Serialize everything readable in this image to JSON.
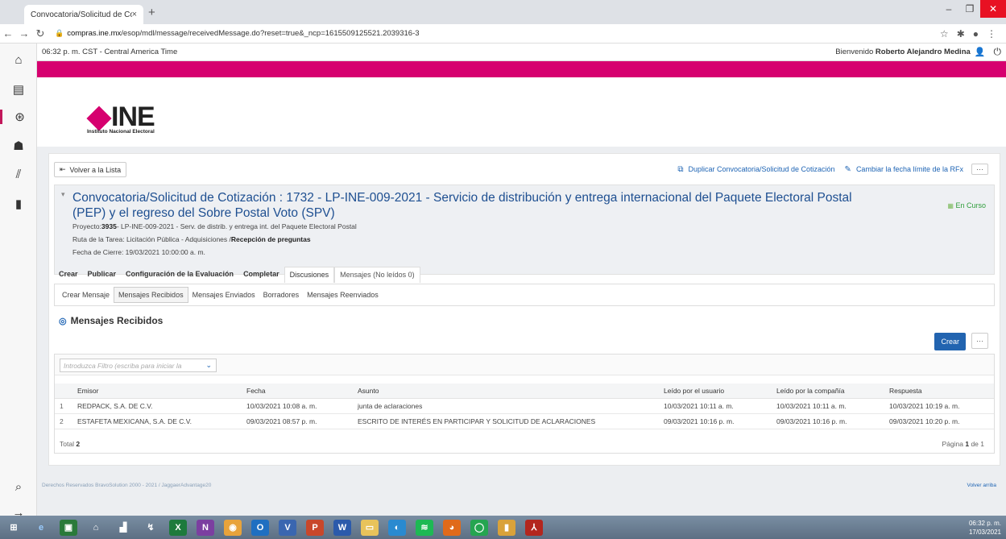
{
  "browser": {
    "tab_title": "Convocatoria/Solicitud de Cotiza",
    "tab_close": "×",
    "new_tab": "+",
    "url_prefix": "compras.ine.mx",
    "url_path": "/esop/mdl/message/receivedMessage.do?reset=true&_ncp=1615509125521.2039316-3"
  },
  "infobar": {
    "time": "06:32 p. m. CST - Central America Time",
    "welcome_prefix": "Bienvenido",
    "user_name": "Roberto Alejandro Medina"
  },
  "logo": {
    "text": "INE",
    "subtitle": "Instituto Nacional Electoral"
  },
  "actions": {
    "back": "Volver a la Lista",
    "duplicate": "Duplicar Convocatoria/Solicitud de Cotización",
    "change_date": "Cambiar la fecha límite de la RFx",
    "more": "···"
  },
  "header": {
    "title": "Convocatoria/Solicitud de Cotización : 1732 - LP-INE-009-2021 - Servicio de distribución y entrega internacional del Paquete Electoral Postal (PEP) y el regreso del Sobre Postal Voto (SPV)",
    "status": "En Curso",
    "project_label": "Proyecto:",
    "project_code": "3935",
    "project_desc": "- LP-INE-009-2021 - Serv. de distrib. y entrega int. del Paquete Electoral Postal",
    "route_label": "Ruta de la Tarea: Licitación Pública - Adquisiciones /",
    "route_current": "Recepción de preguntas",
    "close_date": "Fecha de Cierre: 19/03/2021 10:00:00 a. m."
  },
  "tabs": [
    "Crear",
    "Publicar",
    "Configuración de la Evaluación",
    "Completar",
    "Discusiones",
    "Mensajes (No leídos 0)"
  ],
  "subtabs": [
    "Crear Mensaje",
    "Mensajes Recibidos",
    "Mensajes Enviados",
    "Borradores",
    "Mensajes Reenviados"
  ],
  "section": {
    "title": "Mensajes Recibidos",
    "create_button": "Crear",
    "more": "···"
  },
  "filter": {
    "placeholder": "Introduzca Filtro (escriba para iniciar la",
    "caret": "⌄"
  },
  "table": {
    "headers": [
      "Emisor",
      "Fecha",
      "Asunto",
      "Leído por el usuario",
      "Leído por la compañía",
      "Respuesta"
    ],
    "rows": [
      {
        "n": "1",
        "emisor": "REDPACK, S.A. DE C.V.",
        "fecha": "10/03/2021 10:08 a. m.",
        "asunto": "junta de aclaraciones",
        "leido_usuario": "10/03/2021 10:11 a. m.",
        "leido_compania": "10/03/2021 10:11 a. m.",
        "respuesta": "10/03/2021 10:19 a. m."
      },
      {
        "n": "2",
        "emisor": "ESTAFETA MEXICANA, S.A. DE C.V.",
        "fecha": "09/03/2021 08:57 p. m.",
        "asunto": "ESCRITO DE INTERÉS EN PARTICIPAR Y SOLICITUD DE ACLARACIONES",
        "leido_usuario": "09/03/2021 10:16 p. m.",
        "leido_compania": "09/03/2021 10:16 p. m.",
        "respuesta": "09/03/2021 10:20 p. m."
      }
    ],
    "total_label": "Total",
    "total_value": "2",
    "page_prefix": "Página",
    "page_current": "1",
    "page_suffix": "de 1"
  },
  "footer": {
    "copyright": "Derechos Reservados BravoSolution 2000 - 2021 / JaggaerAdvantage20",
    "back_to_top": "Volver arriba"
  },
  "taskbar": {
    "time": "06:32 p. m.",
    "date": "17/03/2021"
  },
  "colors": {
    "brand_pink": "#d6006f",
    "link_blue": "#1e64b4",
    "status_green": "#2e9d3a"
  }
}
